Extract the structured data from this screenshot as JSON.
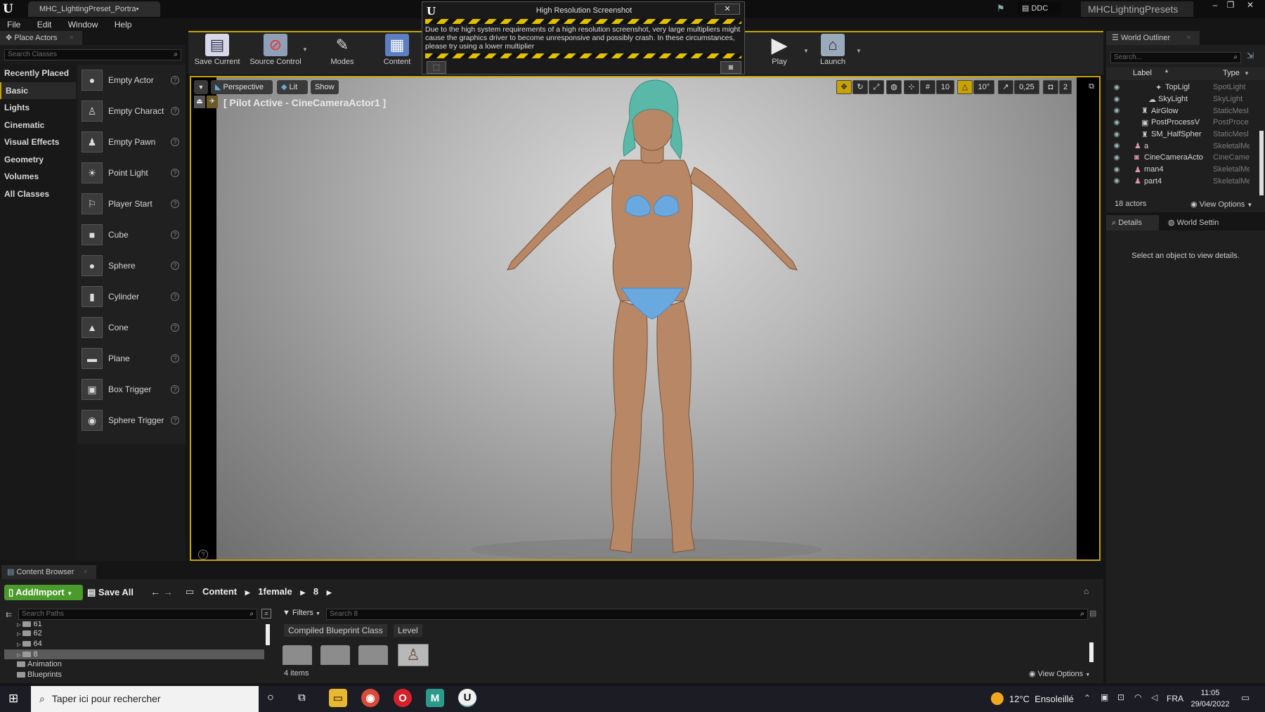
{
  "titlebar": {
    "doc_tab": "MHC_LightingPreset_Portra•",
    "ddc_label": "DDC",
    "project_name": "MHCLightingPresets",
    "min": "–",
    "restore": "❐",
    "close": "✕"
  },
  "menu": [
    "File",
    "Edit",
    "Window",
    "Help"
  ],
  "place_actors": {
    "tab_label": "Place Actors",
    "search_placeholder": "Search Classes",
    "categories": [
      "Recently Placed",
      "Basic",
      "Lights",
      "Cinematic",
      "Visual Effects",
      "Geometry",
      "Volumes",
      "All Classes"
    ],
    "selected_category": "Basic",
    "actors": [
      {
        "label": "Empty Actor",
        "icon": "sphere-icon"
      },
      {
        "label": "Empty Charact",
        "icon": "figure-icon"
      },
      {
        "label": "Empty Pawn",
        "icon": "pawn-icon"
      },
      {
        "label": "Point Light",
        "icon": "bulb-icon"
      },
      {
        "label": "Player Start",
        "icon": "flag-icon"
      },
      {
        "label": "Cube",
        "icon": "cube-icon"
      },
      {
        "label": "Sphere",
        "icon": "sphere-icon"
      },
      {
        "label": "Cylinder",
        "icon": "cylinder-icon"
      },
      {
        "label": "Cone",
        "icon": "cone-icon"
      },
      {
        "label": "Plane",
        "icon": "plane-icon"
      },
      {
        "label": "Box Trigger",
        "icon": "box-trigger-icon"
      },
      {
        "label": "Sphere Trigger",
        "icon": "sphere-trigger-icon"
      }
    ]
  },
  "toolbar": {
    "save_current": "Save Current",
    "source_control": "Source Control",
    "modes": "Modes",
    "content": "Content",
    "play": "Play",
    "launch": "Launch"
  },
  "dialog": {
    "title": "High Resolution Screenshot",
    "message": "Due to the high system requirements of a high resolution screenshot, very large multipliers might cause the graphics driver to become unresponsive and possibly crash. In these circumstances, please try using a lower multiplier",
    "close": "✕"
  },
  "viewport": {
    "perspective": "Perspective",
    "lit": "Lit",
    "show": "Show",
    "pilot_label": "[ Pilot Active - CineCameraActor1 ]",
    "grid_snap": "10",
    "rot_snap": "10°",
    "scale_snap": "0,25",
    "cam_speed": "2"
  },
  "world_outliner": {
    "tab_label": "World Outliner",
    "search_placeholder": "Search...",
    "col_label": "Label",
    "col_type": "Type",
    "rows": [
      {
        "label": "TopLigl",
        "type": "SpotLight",
        "indent": 2
      },
      {
        "label": "SkyLight",
        "type": "SkyLight",
        "indent": 1
      },
      {
        "label": "AirGlow",
        "type": "StaticMesl",
        "indent": 1
      },
      {
        "label": "PostProcessV",
        "type": "PostProce",
        "indent": 1
      },
      {
        "label": "SM_HalfSpher",
        "type": "StaticMesl",
        "indent": 1
      },
      {
        "label": "a",
        "type": "SkeletalMe",
        "indent": 0
      },
      {
        "label": "CineCameraActo",
        "type": "CineCame",
        "indent": 0
      },
      {
        "label": "man4",
        "type": "SkeletalMe",
        "indent": 0
      },
      {
        "label": "part4",
        "type": "SkeletalMe",
        "indent": 0
      }
    ],
    "count": "18 actors",
    "view_options": "View Options"
  },
  "details": {
    "tab_details": "Details",
    "tab_world": "World Settin",
    "empty_message": "Select an object to view details."
  },
  "content_browser": {
    "tab_label": "Content Browser",
    "add_import": "Add/Import",
    "save_all": "Save All",
    "path": [
      "Content",
      "1female",
      "8"
    ],
    "search_paths_placeholder": "Search Paths",
    "filters": "Filters",
    "search_placeholder": "Search 8",
    "filter_chips": [
      "Compiled Blueprint Class",
      "Level"
    ],
    "tree": [
      "61",
      "62",
      "64",
      "8",
      "Animation",
      "Blueprints"
    ],
    "selected_tree": "8",
    "item_count": "4 items",
    "view_options": "View Options"
  },
  "taskbar": {
    "search_placeholder": "Taper ici pour rechercher",
    "weather": "12°C  Ensoleillé",
    "lang": "FRA",
    "time": "11:05",
    "date": "29/04/2022"
  },
  "colors": {
    "accent_yellow": "#e0b020",
    "add_green": "#4a9a2c",
    "panel": "#1f1f1f"
  }
}
